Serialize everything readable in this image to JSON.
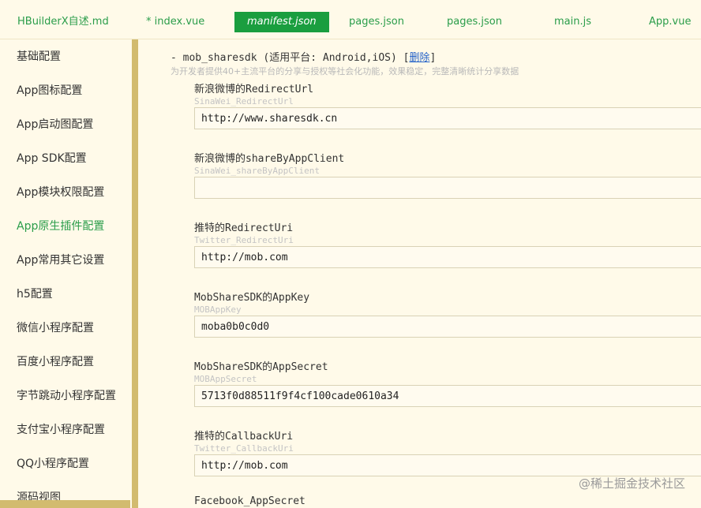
{
  "tabs": [
    {
      "label": "HBuilderX自述.md"
    },
    {
      "label": "* index.vue"
    },
    {
      "label": "manifest.json"
    },
    {
      "label": "pages.json"
    },
    {
      "label": "pages.json"
    },
    {
      "label": "main.js"
    },
    {
      "label": "App.vue"
    }
  ],
  "sidebar": {
    "items": [
      {
        "label": "基础配置"
      },
      {
        "label": "App图标配置"
      },
      {
        "label": "App启动图配置"
      },
      {
        "label": "App SDK配置"
      },
      {
        "label": "App模块权限配置"
      },
      {
        "label": "App原生插件配置"
      },
      {
        "label": "App常用其它设置"
      },
      {
        "label": "h5配置"
      },
      {
        "label": "微信小程序配置"
      },
      {
        "label": "百度小程序配置"
      },
      {
        "label": "字节跳动小程序配置"
      },
      {
        "label": "支付宝小程序配置"
      },
      {
        "label": "QQ小程序配置"
      },
      {
        "label": "源码视图"
      }
    ]
  },
  "section": {
    "title": "- mob_sharesdk (适用平台: Android,iOS) [",
    "delete_label": "删除",
    "title_end": "]",
    "description": "为开发者提供40+主流平台的分享与授权等社会化功能，效果稳定，完整清晰统计分享数据"
  },
  "fields": [
    {
      "label": "新浪微博的RedirectUrl",
      "key": "SinaWei_RedirectUrl",
      "value": "http://www.sharesdk.cn"
    },
    {
      "label": "新浪微博的shareByAppClient",
      "key": "SinaWei_shareByAppClient",
      "value": ""
    },
    {
      "label": "推特的RedirectUri",
      "key": "Twitter_RedirectUri",
      "value": "http://mob.com"
    },
    {
      "label": "MobShareSDK的AppKey",
      "key": "MOBAppKey",
      "value": "moba0b0c0d0"
    },
    {
      "label": "MobShareSDK的AppSecret",
      "key": "MOBAppSecret",
      "value": "5713f0d88511f9f4cf100cade0610a34"
    },
    {
      "label": "推特的CallbackUri",
      "key": "Twitter_CallbackUri",
      "value": "http://mob.com"
    },
    {
      "label": "Facebook_AppSecret",
      "key": "",
      "value": ""
    }
  ],
  "watermark": "@稀土掘金技术社区"
}
